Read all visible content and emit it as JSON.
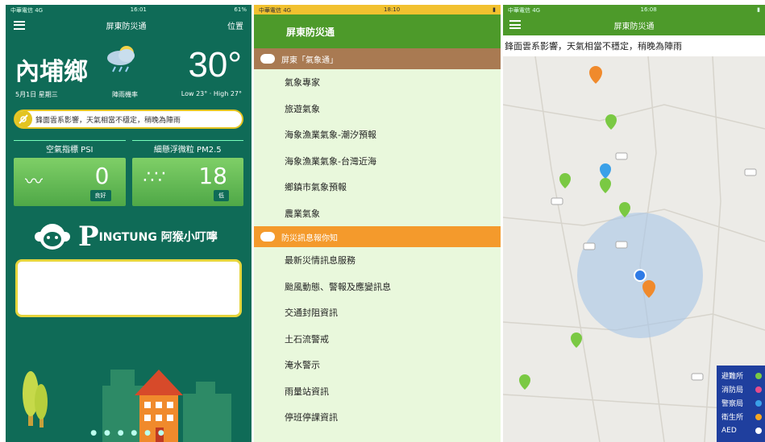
{
  "panel1": {
    "status_left": "中華電信 4G",
    "status_time": "16:01",
    "status_right": "61%",
    "nav_title": "屏東防災通",
    "nav_location": "位置",
    "town": "內埔鄉",
    "temperature": "30°",
    "date": "5月1日 星期三",
    "condition": "陣雨機率",
    "low_high": "Low 23° · High 27°",
    "ticker": "鋒面雲系影響，天氣相當不穩定，稍晚為陣雨",
    "psi_title": "空氣指標 PSI",
    "psi_value": "0",
    "psi_badge": "良好",
    "pm_title": "細懸浮微粒 PM2.5",
    "pm_value": "18",
    "pm_badge": "低",
    "brand_letter": "P",
    "brand_text": "INGTUNG 阿猴小叮嚀",
    "page_dots": "● ● ● ● ● ●"
  },
  "panel2": {
    "status_left": "中華電信 4G",
    "status_time": "18:10",
    "header": "屏東防災通",
    "section1": "屏東「氣象通」",
    "items1": [
      "氣象專家",
      "旅遊氣象",
      "海象漁業氣象-潮汐預報",
      "海象漁業氣象-台灣近海",
      "鄉鎮市氣象預報",
      "農業氣象"
    ],
    "section2": "防災訊息報你知",
    "items2": [
      "最新災情訊息服務",
      "颱風動態、警報及應變訊息",
      "交通封阻資訊",
      "土石流警戒",
      "淹水警示",
      "雨量站資訊",
      "停班停課資訊"
    ]
  },
  "panel3": {
    "status_left": "中華電信 4G",
    "status_time": "16:08",
    "header": "屏東防災通",
    "ticker": "鋒面雲系影響，天氣相當不穩定，稍晚為陣雨",
    "legend": [
      {
        "label": "避難所",
        "color": "#7ac943"
      },
      {
        "label": "消防局",
        "color": "#e84c8b"
      },
      {
        "label": "警察局",
        "color": "#3aa0e8"
      },
      {
        "label": "衛生所",
        "color": "#f5a623"
      },
      {
        "label": "AED",
        "color": "#ffffff"
      }
    ]
  }
}
